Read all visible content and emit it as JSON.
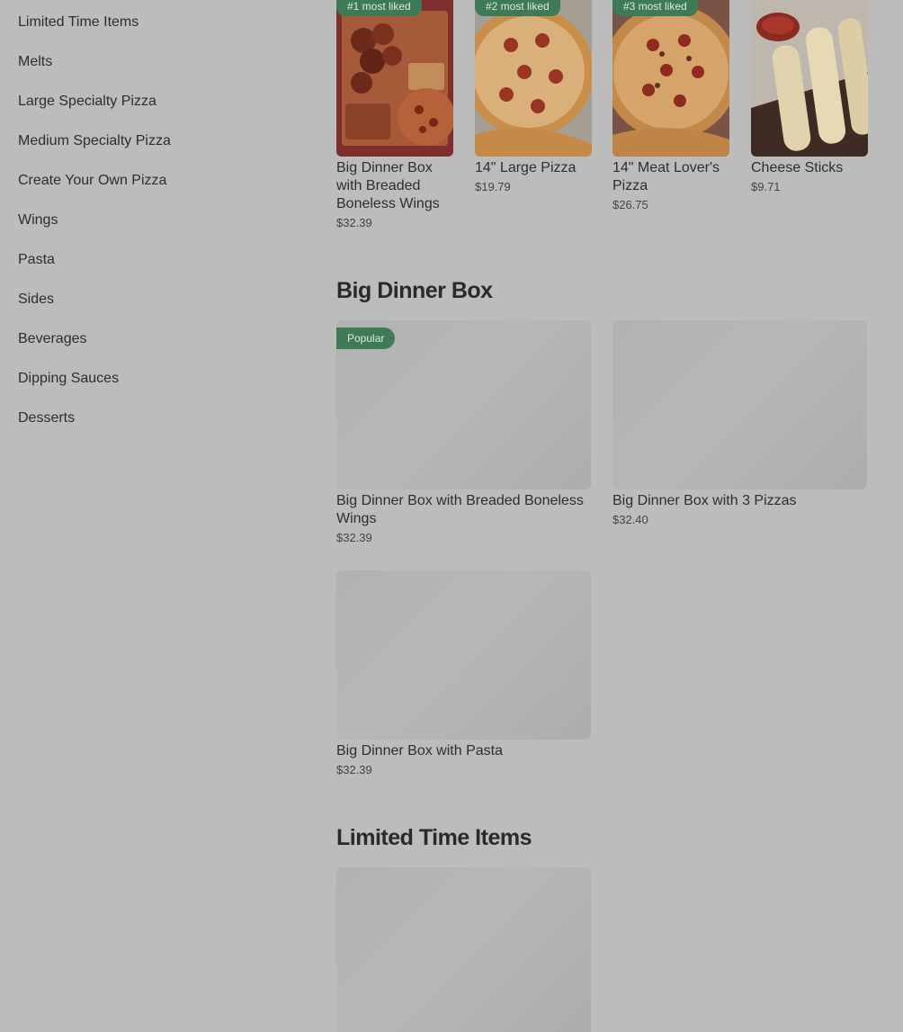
{
  "sidebar": {
    "items": [
      {
        "label": "Limited Time Items"
      },
      {
        "label": "Melts"
      },
      {
        "label": "Large Specialty Pizza"
      },
      {
        "label": "Medium Specialty Pizza"
      },
      {
        "label": "Create Your Own Pizza"
      },
      {
        "label": "Wings"
      },
      {
        "label": "Pasta"
      },
      {
        "label": "Sides"
      },
      {
        "label": "Beverages"
      },
      {
        "label": "Dipping Sauces"
      },
      {
        "label": "Desserts"
      }
    ]
  },
  "featured": [
    {
      "badge": "#1 most liked",
      "title": "Big Dinner Box with Breaded Boneless Wings",
      "price": "$32.39",
      "image": "wings-pizza-box"
    },
    {
      "badge": "#2 most liked",
      "title": "14\" Large Pizza",
      "price": "$19.79",
      "image": "pepperoni-pizza"
    },
    {
      "badge": "#3 most liked",
      "title": "14\" Meat Lover's Pizza",
      "price": "$26.75",
      "image": "meat-pizza"
    },
    {
      "badge": "",
      "title": "Cheese Sticks",
      "price": "$9.71",
      "image": "cheese-sticks"
    }
  ],
  "sections": {
    "big_dinner_box": {
      "title": "Big Dinner Box",
      "items": [
        {
          "badge": "Popular",
          "title": "Big Dinner Box with Breaded Boneless Wings",
          "price": "$32.39"
        },
        {
          "badge": "",
          "title": "Big Dinner Box with 3 Pizzas",
          "price": "$32.40"
        },
        {
          "badge": "",
          "title": "Big Dinner Box with Pasta",
          "price": "$32.39"
        }
      ]
    },
    "limited_time": {
      "title": "Limited Time Items"
    }
  },
  "colors": {
    "background": "#bcbcbc",
    "badge_green": "#3e7a56",
    "text": "#2a2a2a"
  }
}
